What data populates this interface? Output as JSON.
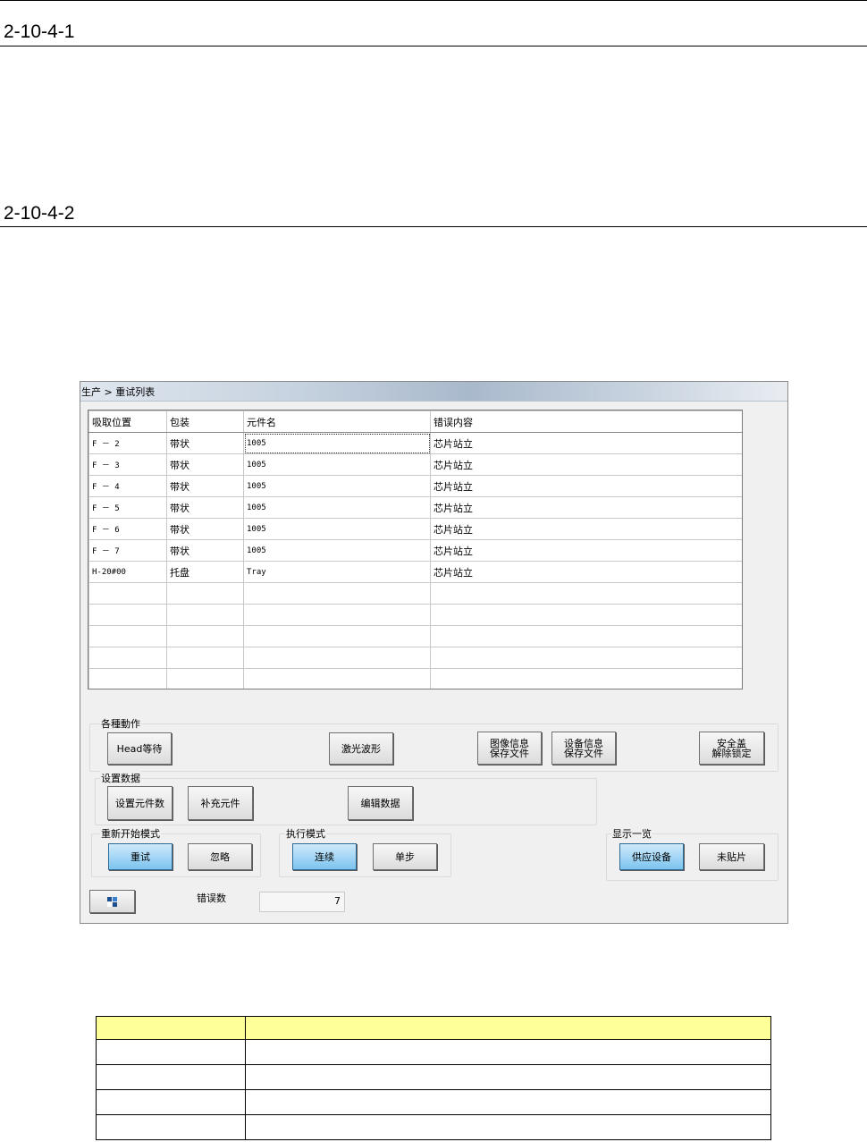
{
  "headings": {
    "h1": "2-10-4-1",
    "h2": "2-10-4-2"
  },
  "window": {
    "breadcrumb": "生产 > 重试列表",
    "grid": {
      "columns": [
        "吸取位置",
        "包装",
        "元件名",
        "错误内容"
      ],
      "rows": [
        [
          "F －  2",
          "带状",
          "1005",
          "芯片站立"
        ],
        [
          "F －  3",
          "带状",
          "1005",
          "芯片站立"
        ],
        [
          "F －  4",
          "带状",
          "1005",
          "芯片站立"
        ],
        [
          "F －  5",
          "带状",
          "1005",
          "芯片站立"
        ],
        [
          "F －  6",
          "带状",
          "1005",
          "芯片站立"
        ],
        [
          "F －  7",
          "带状",
          "1005",
          "芯片站立"
        ],
        [
          "H-20#00",
          "托盘",
          "Tray",
          "芯片站立"
        ],
        [
          "",
          "",
          "",
          ""
        ],
        [
          "",
          "",
          "",
          ""
        ],
        [
          "",
          "",
          "",
          ""
        ],
        [
          "",
          "",
          "",
          ""
        ],
        [
          "",
          "",
          "",
          ""
        ]
      ]
    },
    "actions": {
      "label": "各種動作",
      "head_wait": "Head等待",
      "laser_wave": "激光波形",
      "save_image_1": "图像信息",
      "save_image_2": "保存文件",
      "save_device_1": "设备信息",
      "save_device_2": "保存文件",
      "safety_1": "安全盖",
      "safety_2": "解除锁定"
    },
    "settings": {
      "label": "设置数据",
      "set_count": "设置元件数",
      "replenish": "补充元件",
      "edit_data": "编辑数据"
    },
    "restart": {
      "label": "重新开始模式",
      "retry": "重试",
      "ignore": "忽略"
    },
    "exec": {
      "label": "执行模式",
      "continuous": "连续",
      "step": "单步"
    },
    "display": {
      "label": "显示一览",
      "feeder": "供应设备",
      "unplaced": "未贴片"
    },
    "error_count_label": "错误数",
    "error_count_value": "7"
  },
  "colors": {
    "active_button": "#7cc4ef",
    "table_header": "#ffff99"
  }
}
